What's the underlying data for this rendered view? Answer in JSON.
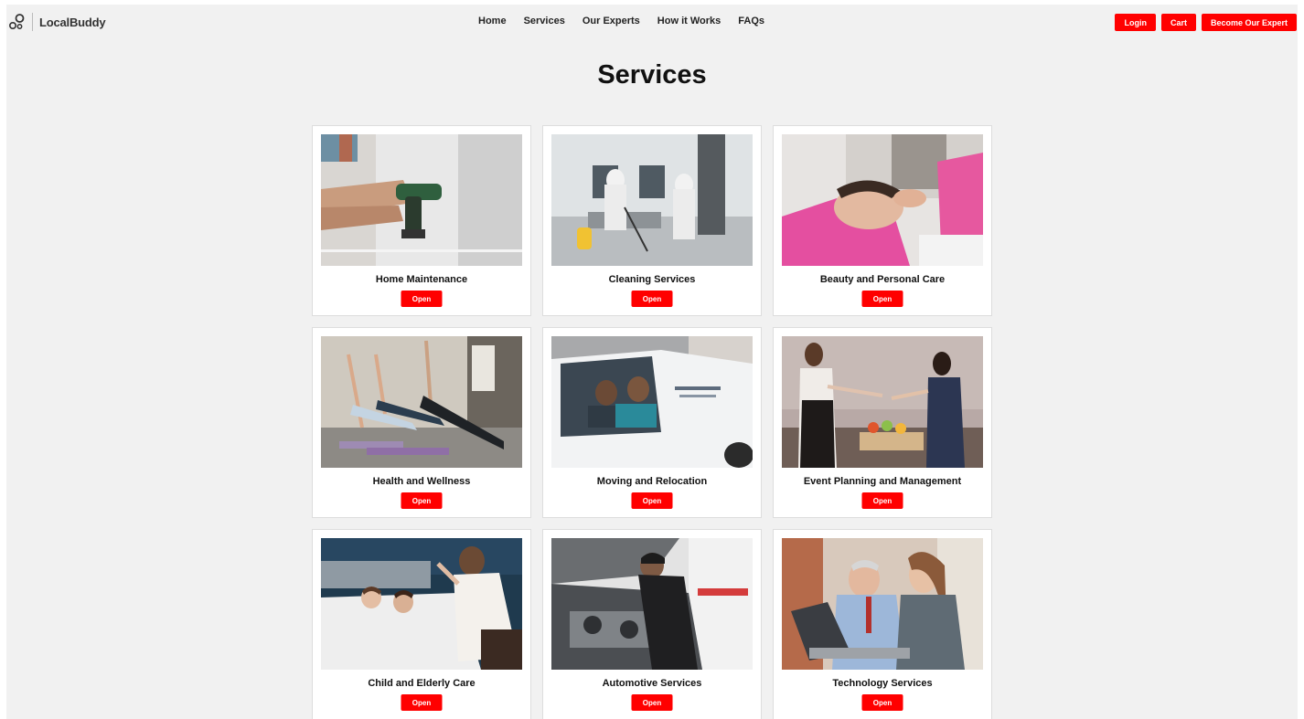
{
  "brand": {
    "name": "LocalBuddy",
    "icon": "local-buddy-logo-icon"
  },
  "nav": {
    "items": [
      {
        "label": "Home"
      },
      {
        "label": "Services"
      },
      {
        "label": "Our Experts"
      },
      {
        "label": "How it Works"
      },
      {
        "label": "FAQs"
      }
    ]
  },
  "actions": {
    "login_label": "Login",
    "cart_label": "Cart",
    "become_expert_label": "Become Our Expert"
  },
  "page": {
    "title": "Services"
  },
  "services": [
    {
      "title": "Home Maintenance",
      "open_label": "Open",
      "image": "drill-worker-photo"
    },
    {
      "title": "Cleaning Services",
      "open_label": "Open",
      "image": "cleaning-crew-photo"
    },
    {
      "title": "Beauty and Personal Care",
      "open_label": "Open",
      "image": "beauty-treatment-photo"
    },
    {
      "title": "Health and Wellness",
      "open_label": "Open",
      "image": "yoga-class-photo"
    },
    {
      "title": "Moving and Relocation",
      "open_label": "Open",
      "image": "moving-van-photo"
    },
    {
      "title": "Event Planning and Management",
      "open_label": "Open",
      "image": "event-handshake-photo"
    },
    {
      "title": "Child and Elderly Care",
      "open_label": "Open",
      "image": "bedroom-care-photo"
    },
    {
      "title": "Automotive Services",
      "open_label": "Open",
      "image": "car-mechanic-photo"
    },
    {
      "title": "Technology Services",
      "open_label": "Open",
      "image": "laptop-help-photo"
    }
  ],
  "colors": {
    "accent": "#ff0000",
    "page_bg": "#f1f1f1",
    "card_bg": "#ffffff"
  }
}
